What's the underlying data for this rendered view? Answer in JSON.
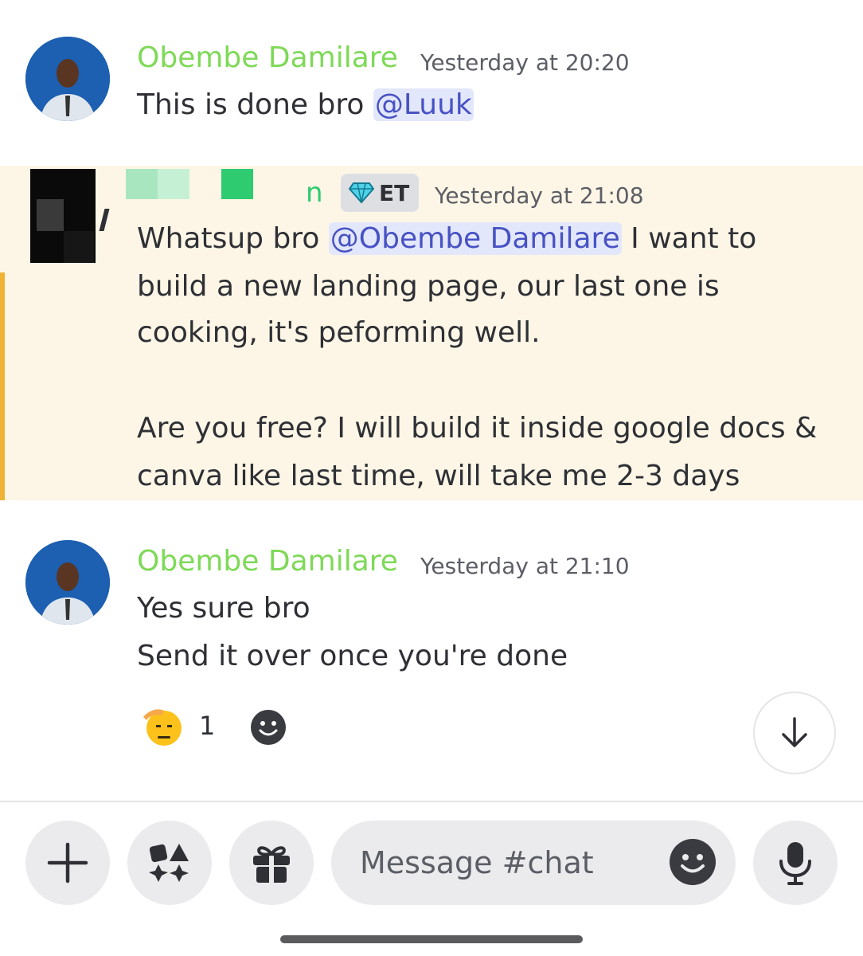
{
  "messages": [
    {
      "username": "Obembe Damilare",
      "timestamp": "Yesterday at 20:20",
      "text_before_mention": "This is done bro ",
      "mention": "@Luuk"
    },
    {
      "username_partial": "n",
      "badge": "ET",
      "timestamp": "Yesterday at 21:08",
      "lines": [
        {
          "before": "Whatsup bro ",
          "mention": "@Obembe Damilare",
          "after": " I want to"
        },
        "build a new landing page, our last one is",
        "cooking, it's peforming well.",
        "Are you free? I will build it inside google docs &",
        "canva like last time, will take me 2-3 days"
      ]
    },
    {
      "username": "Obembe Damilare",
      "timestamp": "Yesterday at 21:10",
      "lines": [
        "Yes sure bro",
        "Send it over once you're done"
      ],
      "reaction": {
        "emoji": "saluting-face",
        "count": "1"
      }
    }
  ],
  "composer": {
    "placeholder": "Message #chat"
  },
  "icons": {
    "add": "plus-icon",
    "apps": "apps-icon",
    "gift": "gift-icon",
    "emoji": "emoji-icon",
    "mic": "microphone-icon",
    "scroll": "arrow-down-icon"
  },
  "colors": {
    "username": "#7ed957",
    "mention_bg": "#e3e7fb",
    "mention_text": "#4752c4",
    "highlight_bg": "#fdf6e6",
    "highlight_bar": "#f0b232"
  }
}
